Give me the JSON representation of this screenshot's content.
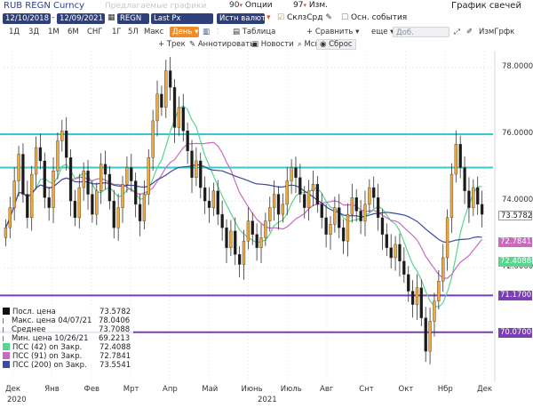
{
  "header": {
    "ticker": "RUB REGN Curncy",
    "suggested": "Предлагаемые графики",
    "options_label": "Опции",
    "options_num": "90",
    "edit_label": "Изм.",
    "edit_num": "97",
    "chart_type": "График свечей"
  },
  "toolbar2": {
    "date_from": "12/10/2018",
    "date_to": "12/09/2021",
    "ticker_code": "REGN",
    "field": "Last Px",
    "source": "Истн валют",
    "moving_avg": "СклзСрд",
    "main_events": "Осн. события"
  },
  "toolbar3": {
    "periods": [
      "1Д",
      "3Д",
      "1М",
      "6М",
      "СНГ",
      "1Г",
      "5Л",
      "Макс"
    ],
    "frequency": "День",
    "table": "Таблица",
    "compare": "Сравнить",
    "more": "еще",
    "add_data": "Доб. данные",
    "chart_settings": "ИзмГрфк"
  },
  "toolbar4": {
    "trend": "Трек",
    "annotate": "Аннотировать",
    "news": "Новости",
    "zoom": "Мсшт",
    "reset": "Сброс"
  },
  "colors": {
    "navy": "#2f3f7a",
    "orange": "#f08a24",
    "cyan_line": "#38c8d2",
    "purple_line": "#7a3fb2",
    "ma42": "#58d68d",
    "ma91": "#c86bc0",
    "ma200": "#3d4aa0",
    "up_candle": "#f2a93b",
    "down_candle": "#1a1a1a"
  },
  "legend": [
    {
      "label": "Посл. цена",
      "value": "73.5782",
      "swatch": "#111111"
    },
    {
      "label": "Макс. цена 04/07/21",
      "value": "78.0406",
      "swatch": ""
    },
    {
      "label": "Среднее",
      "value": "73.7088",
      "swatch": ""
    },
    {
      "label": "Мин. цена 10/26/21",
      "value": "69.2213",
      "swatch": ""
    },
    {
      "label": "ПСС (42)  on Закр.",
      "value": "72.4088",
      "swatch": "#58d68d"
    },
    {
      "label": "ПСС (91)  on Закр.",
      "value": "72.7841",
      "swatch": "#c86bc0"
    },
    {
      "label": "ПСС (200)  on Закр.",
      "value": "73.5541",
      "swatch": "#3d4aa0"
    }
  ],
  "price_tags": [
    {
      "value": "73.5782",
      "bg": "#ffffff",
      "fg": "#222222"
    },
    {
      "value": "72.7841",
      "bg": "#c86bc0",
      "fg": "#ffffff"
    },
    {
      "value": "72.4088",
      "bg": "#58d68d",
      "fg": "#ffffff"
    },
    {
      "value": "71.1700",
      "bg": "#7a3fb2",
      "fg": "#ffffff"
    },
    {
      "value": "70.0700",
      "bg": "#7a3fb2",
      "fg": "#ffffff"
    }
  ],
  "hlines": [
    {
      "value": 76.0,
      "color": "#38c8d2"
    },
    {
      "value": 75.0,
      "color": "#38c8d2"
    },
    {
      "value": 71.17,
      "color": "#7a3fb2"
    },
    {
      "value": 70.07,
      "color": "#7a3fb2"
    }
  ],
  "chart_data": {
    "type": "candlestick",
    "y_ticks": [
      72.0,
      74.0,
      76.0,
      78.0
    ],
    "y_tick_labels": [
      "72.0000",
      "74.0000",
      "76.0000",
      "78.0000"
    ],
    "ylim": [
      68.6,
      78.5
    ],
    "x_labels": [
      "Дек",
      "Янв",
      "Фев",
      "Мрт",
      "Апр",
      "Май",
      "Июнь",
      "Июль",
      "Авг",
      "Снт",
      "Окт",
      "Нбр",
      "Дек"
    ],
    "year_labels": [
      "2020",
      "2021"
    ],
    "close": [
      73.2,
      73.8,
      74.6,
      75.4,
      74.2,
      73.5,
      74.8,
      75.6,
      75.2,
      74.1,
      73.8,
      74.9,
      75.8,
      76.1,
      75.3,
      74.0,
      73.5,
      74.4,
      74.9,
      74.2,
      73.6,
      74.3,
      75.1,
      74.8,
      74.0,
      73.2,
      73.8,
      74.5,
      75.0,
      74.6,
      73.9,
      73.4,
      74.2,
      75.3,
      76.4,
      77.2,
      76.8,
      77.9,
      77.4,
      76.2,
      76.8,
      76.1,
      75.5,
      74.7,
      75.2,
      74.4,
      74.0,
      73.8,
      74.3,
      73.6,
      73.2,
      72.6,
      73.1,
      72.4,
      72.1,
      72.8,
      73.4,
      73.0,
      72.6,
      72.9,
      73.4,
      73.8,
      74.2,
      73.6,
      73.9,
      74.6,
      75.0,
      74.7,
      74.2,
      73.8,
      74.3,
      74.5,
      73.9,
      73.5,
      73.0,
      73.3,
      73.8,
      73.2,
      72.8,
      73.6,
      74.1,
      73.7,
      73.4,
      73.9,
      74.4,
      74.1,
      73.5,
      73.0,
      72.6,
      72.3,
      72.7,
      72.2,
      71.8,
      71.3,
      70.9,
      71.4,
      70.5,
      69.5,
      70.4,
      71.0,
      71.6,
      72.3,
      73.5,
      74.8,
      75.7,
      75.0,
      74.3,
      73.8,
      74.4,
      73.9,
      73.6
    ]
  }
}
